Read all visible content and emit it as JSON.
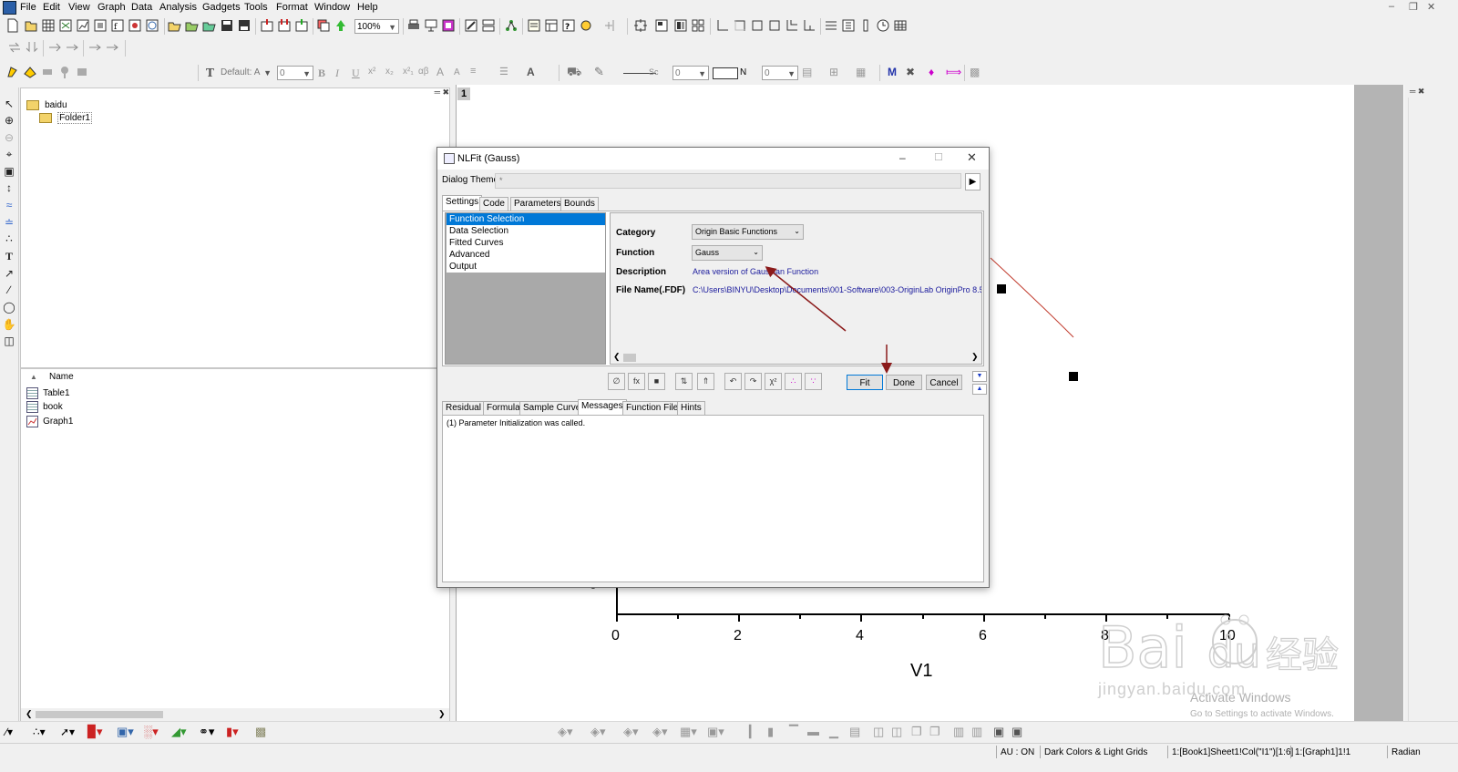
{
  "menubar": {
    "items": [
      "File",
      "Edit",
      "View",
      "Graph",
      "Data",
      "Analysis",
      "Gadgets",
      "Tools",
      "Format",
      "Window",
      "Help"
    ]
  },
  "toolbar": {
    "zoom": "100%",
    "font_name": "Default: A",
    "font_size": "0",
    "line_style": "Sc",
    "line_width": "0",
    "fill_label": "N",
    "fill_value": "0"
  },
  "project": {
    "root": "baidu",
    "folder": "Folder1",
    "list_header": "Name",
    "items": [
      "Table1",
      "book",
      "Graph1"
    ]
  },
  "graph": {
    "layer_tab": "1",
    "x_ticks": [
      "0",
      "2",
      "4",
      "6",
      "8",
      "10"
    ],
    "x_axis_title": "V1",
    "y_partial_label": "0"
  },
  "dialog": {
    "title": "NLFit (Gauss)",
    "theme_label": "Dialog Theme",
    "theme_value": "*",
    "top_tabs": [
      "Settings",
      "Code",
      "Parameters",
      "Bounds"
    ],
    "left_items": [
      "Function Selection",
      "Data Selection",
      "Fitted Curves",
      "Advanced",
      "Output"
    ],
    "category_label": "Category",
    "category_value": "Origin Basic Functions",
    "function_label": "Function",
    "function_value": "Gauss",
    "description_label": "Description",
    "description_value": "Area version of Gaussian Function",
    "filename_label": "File Name(.FDF)",
    "filename_value": "C:\\Users\\BINYU\\Desktop\\Documents\\001-Software\\003-OriginLab OriginPro 8.5",
    "fit_label": "Fit",
    "done_label": "Done",
    "cancel_label": "Cancel",
    "bottom_tabs": [
      "Residual",
      "Formula",
      "Sample Curve",
      "Messages",
      "Function File",
      "Hints"
    ],
    "message": "(1) Parameter Initialization was called."
  },
  "status": {
    "au": "AU : ON",
    "theme": "Dark Colors & Light Grids",
    "cell": "1:[Book1]Sheet1!Col(\"I1\")[1:6]",
    "graph": "1:[Graph1]1!1",
    "unit": "Radian"
  },
  "watermark": {
    "activate_title": "Activate Windows",
    "activate_sub": "Go to Settings to activate Windows.",
    "site": "jingyan.baidu.com"
  },
  "colors": {
    "selection": "#0078d7",
    "dialog_value_text": "#1a1a9c",
    "fit_curve": "#c0392b",
    "annotation_arrow": "#8b1a1a"
  }
}
